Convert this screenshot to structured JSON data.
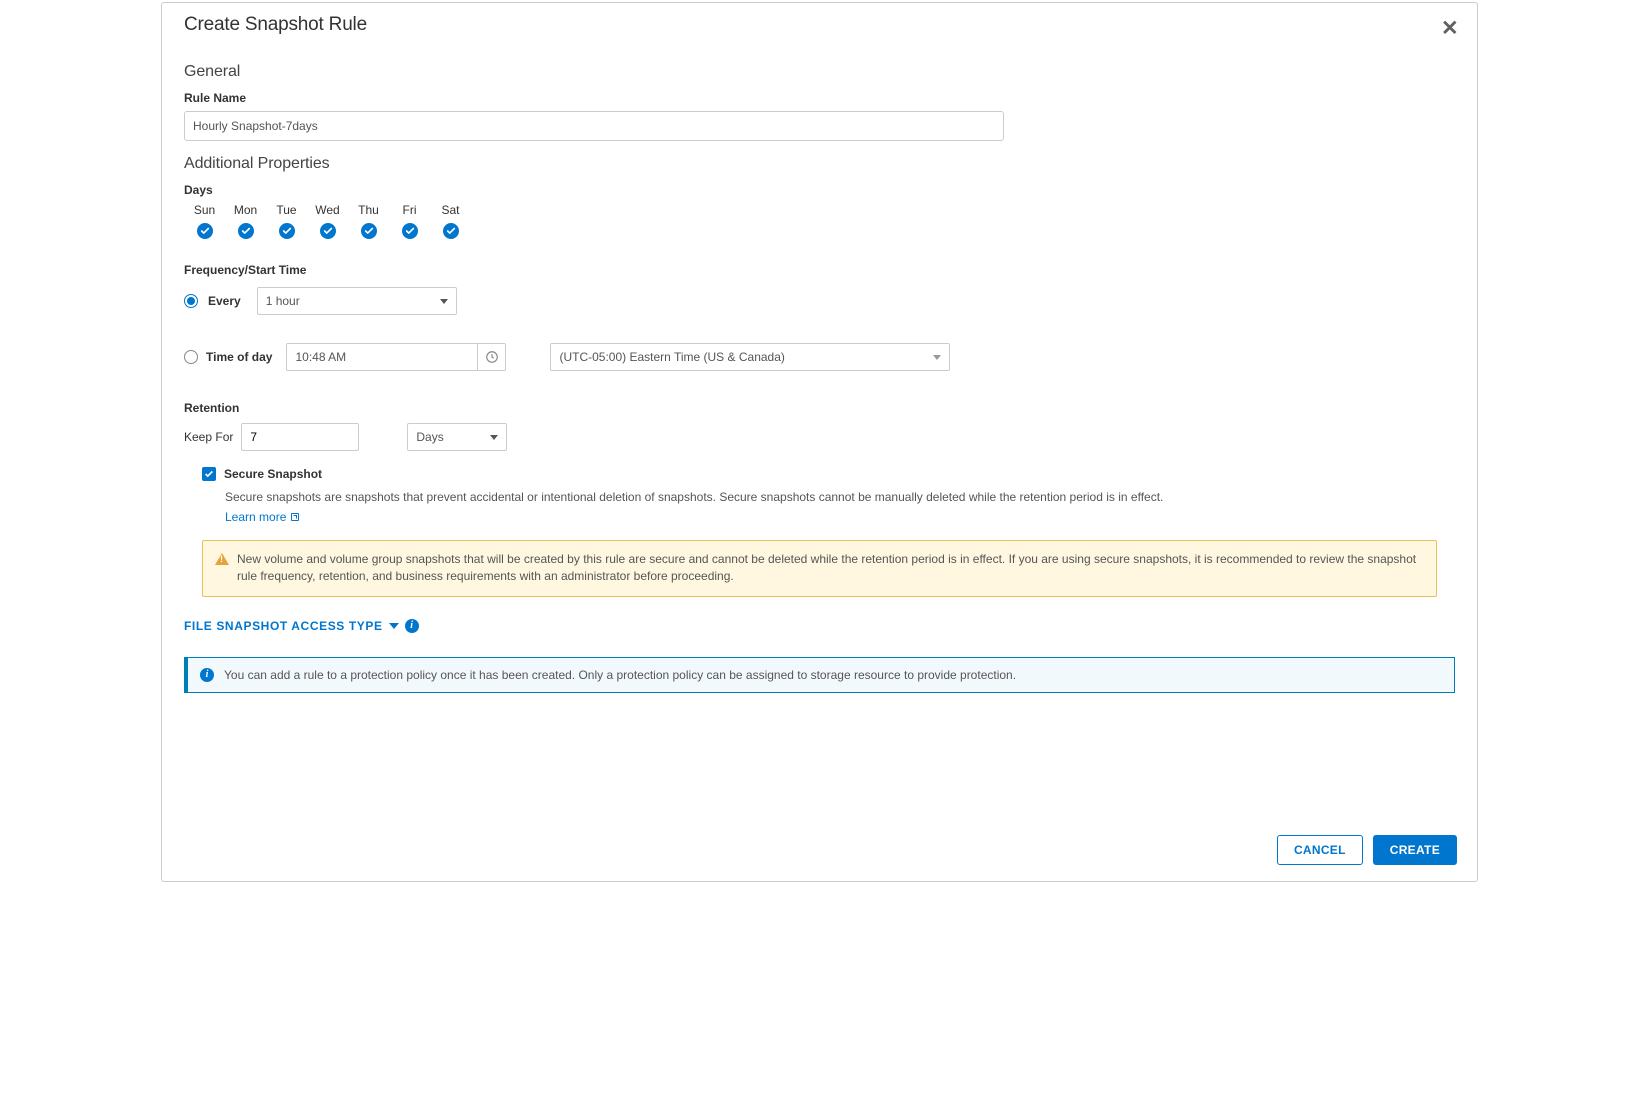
{
  "modal": {
    "title": "Create Snapshot Rule"
  },
  "general": {
    "heading": "General",
    "rule_name_label": "Rule Name",
    "rule_name_value": "Hourly Snapshot-7days"
  },
  "additional": {
    "heading": "Additional Properties",
    "days_label": "Days",
    "days": [
      {
        "short": "Sun",
        "checked": true
      },
      {
        "short": "Mon",
        "checked": true
      },
      {
        "short": "Tue",
        "checked": true
      },
      {
        "short": "Wed",
        "checked": true
      },
      {
        "short": "Thu",
        "checked": true
      },
      {
        "short": "Fri",
        "checked": true
      },
      {
        "short": "Sat",
        "checked": true
      }
    ],
    "frequency_label": "Frequency/Start Time",
    "every": {
      "label": "Every",
      "selected": true,
      "value": "1 hour"
    },
    "timeofday": {
      "label": "Time of day",
      "selected": false,
      "value": "10:48 AM",
      "timezone": "(UTC-05:00) Eastern Time (US & Canada)"
    }
  },
  "retention": {
    "heading": "Retention",
    "keepfor_label": "Keep For",
    "keepfor_value": "7",
    "keepfor_unit": "Days"
  },
  "secure": {
    "checked": true,
    "title": "Secure Snapshot",
    "desc": "Secure snapshots are snapshots that prevent accidental or intentional deletion of snapshots. Secure snapshots cannot be manually deleted while the retention period is in effect.",
    "learn_more": "Learn more",
    "warning": "New volume and volume group snapshots that will be created by this rule are secure and cannot be deleted while the retention period is in effect. If you are using secure snapshots, it is recommended to review the snapshot rule frequency, retention, and business requirements with an administrator before proceeding."
  },
  "access_type": {
    "label": "FILE SNAPSHOT ACCESS TYPE"
  },
  "info": {
    "text": "You can add a rule to a protection policy once it has been created. Only a protection policy can be assigned to storage resource to provide protection."
  },
  "footer": {
    "cancel": "CANCEL",
    "create": "CREATE"
  }
}
